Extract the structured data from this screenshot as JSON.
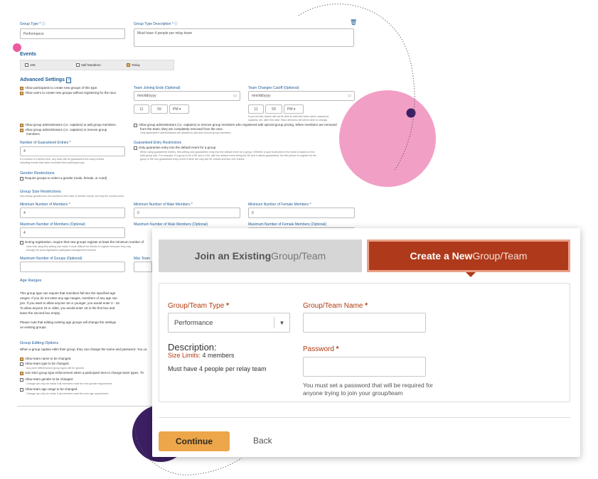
{
  "colors": {
    "accent": "#ae3a1b",
    "accent_light": "#e9a188",
    "continue": "#eda64a",
    "form_blue": "#1d5a96",
    "pink": "#f29fc5",
    "purple": "#3c1f63"
  },
  "bg_form": {
    "group_type_label": "Group Type *",
    "group_type_value": "Performance",
    "desc_label": "Group Type Description *",
    "desc_value": "Must have 4 people per relay team",
    "events_heading": "Events",
    "events": [
      "10K",
      "Half Marathon",
      "Relay"
    ],
    "adv_heading": "Advanced Settings",
    "adv_toggle": "−",
    "adv_left": [
      "Allow participants to create new groups of this type.",
      "Allow users to create new groups without registering for the race."
    ],
    "team_join_ends_label": "Team Joining Ends (Optional)",
    "team_changes_cutoff_label": "Team Changes Cutoff (Optional)",
    "date_placeholder": "mm/dd/yyyy",
    "hour": "11",
    "minute": "59",
    "ampm": "PM",
    "cutoff_note_1": "If you set this, teams will not be able to edit their team name, password,",
    "cutoff_note_2": "captains, etc. after this date. Race directors will still be able to change.",
    "admin_left_1": "Allow group administrators (i.e. captains) to add group members.",
    "admin_left_2": "Allow group administrators (i.e. captains) to remove group",
    "admin_left_3": "members.",
    "admin_right_1": "Allow group administrators (i.e. captains) to remove group members who registered with special group pricing. When members are removed",
    "admin_right_2": "from the team, they are completely removed from the race.",
    "admin_right_3": "Only applicable if administrators are allowed to add and remove group members.",
    "guaranteed_entries_label": "Number of Guaranteed Entries *",
    "guaranteed_entries_value": "4",
    "guaranteed_note_1": "If a number is entered here, any team will be guaranteed this many entries,",
    "guaranteed_note_2": "including events that have exceeded their participant cap.",
    "guaranteed_restrict_label": "Guaranteed Entry Restrictions",
    "guaranteed_restrict_opt": "Only guarantee entry into the default event for a group.",
    "guaranteed_restrict_note_1": "When using guaranteed entries, this setting only guarantees entry into the default event for a group. Whether a spot is allowed in the event is based on the",
    "guaranteed_restrict_note_2": "total group size. For example, if a group is for a 5K and a 10K, with the default event being the 5K and it allows guaranteed, the 6th person to register for the",
    "guaranteed_restrict_note_3": "group in the non guaranteed entry event if there are only two 5K entries and two 10K entries.",
    "gender_heading": "Gender Restrictions",
    "gender_opt": "Require groups to select a gender (male, female, or coed)",
    "size_heading": "Group Size Restrictions",
    "size_note": "Non-binary genders are not counted in the male or female counts, but only the overall count.",
    "min_members_label": "Minimum Number of Members *",
    "min_members_value": "4",
    "min_male_label": "Minimum Number of Male Members *",
    "min_male_value": "0",
    "min_female_label": "Minimum Number of Female Members *",
    "min_female_value": "0",
    "max_members_label": "Maximum Number of Members (Optional)",
    "max_members_value": "4",
    "max_male_label": "Maximum Number of Male Members (Optional)",
    "max_female_label": "Maximum Number of Female Members (Optional)",
    "during_reg_opt": "During registration, require that new groups register at least the minimum number of",
    "during_reg_note_1": "Note that using this setting can make it more difficult for friends to register because they may",
    "during_reg_note_2": "through the post-registration participant management screens.",
    "max_groups_label": "Maximum Number of Groups (Optional)",
    "max_team_label": "Max Team",
    "age_heading": "Age Ranges",
    "age_text": [
      "This group type can require that members fall into the specified age",
      "ranges. If you do not enter any age ranges, members of any age can",
      "join. If you want to allow anyone 18 or younger, you would enter 0 - 18.",
      "To allow anyone 18 or older, you would enter 18 in the first box and",
      "leave the second box empty."
    ],
    "age_text_2": [
      "Please note that editing existing age groups will change the settings",
      "on existing groups."
    ],
    "edit_heading": "Group Editing Options",
    "edit_intro": "When a group captain edits their group, they can change the name and password. You ca",
    "edit_opt_1": "Allow team name to be changed.",
    "edit_opt_2": "Allow team type to be changed.",
    "edit_note_2": "Any price differences in group types will be ignored.",
    "edit_opt_3": "Use strict group type enforcement when a participant tries to change team types. Th",
    "edit_opt_4": "Allow team gender to be changed.",
    "edit_note_4": "Change can only be made if all members meet the new gender requirement.",
    "edit_opt_5": "Allow team age range to be changed.",
    "edit_note_5": "Change can only be made if all members meet the new age requirement."
  },
  "modal": {
    "tab_join_bold": "Join an Existing",
    "tab_join_rest": " Group/Team",
    "tab_create_bold": "Create a New",
    "tab_create_rest": " Group/Team",
    "group_type_label": "Group/Team Type",
    "required_mark": " *",
    "group_type_value": "Performance",
    "group_name_label": "Group/Team Name",
    "group_name_value": "",
    "description_heading": "Description:",
    "size_limits_label": "Size Limits:",
    "size_limits_value": " 4 members",
    "description_text": "Must have 4 people per relay team",
    "password_label": "Password",
    "password_value": "",
    "password_note_1": "You must set a password that will be required for",
    "password_note_2": "anyone trying to join your group/team",
    "continue_label": "Continue",
    "back_label": "Back"
  }
}
